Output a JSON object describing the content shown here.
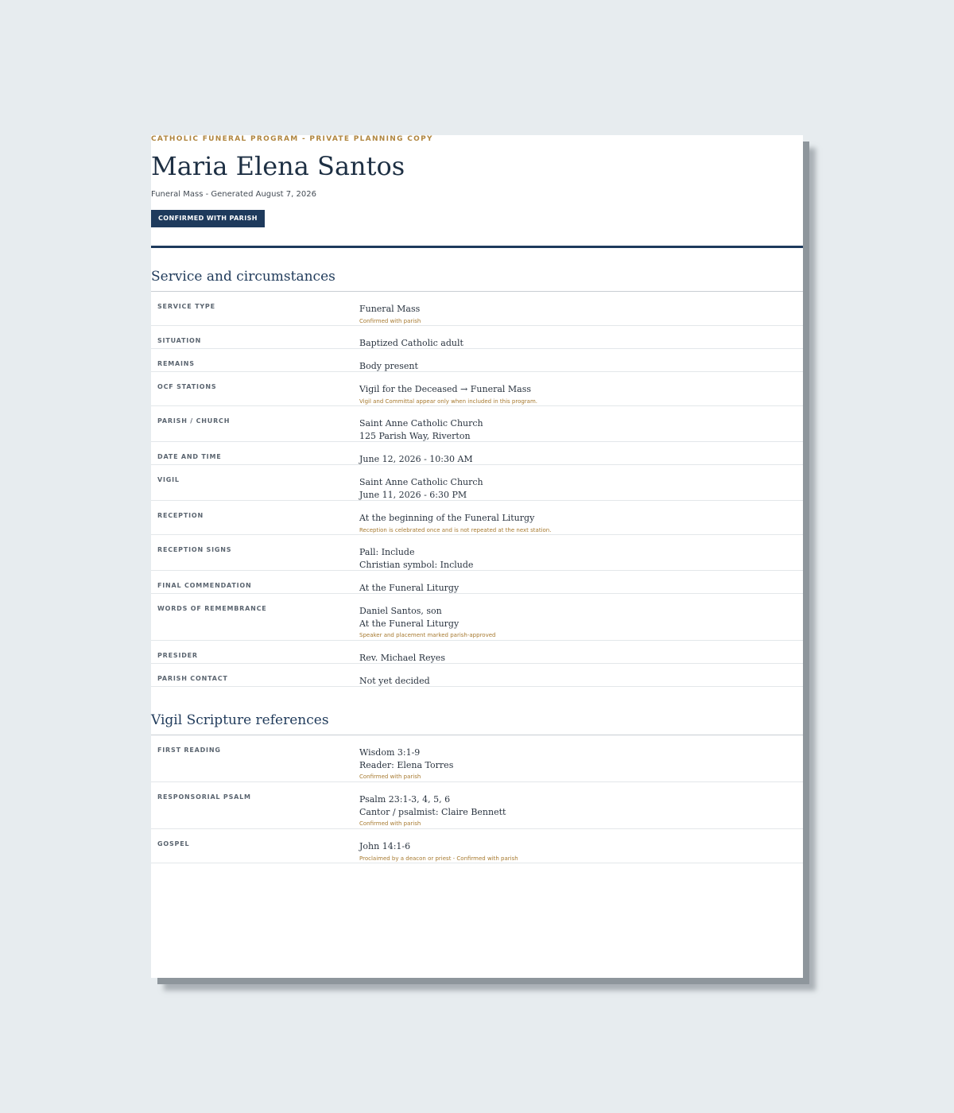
{
  "header": {
    "eyebrow": "CATHOLIC FUNERAL PROGRAM - PRIVATE PLANNING COPY",
    "name": "Maria Elena Santos",
    "generated": "Funeral Mass - Generated August 7, 2026",
    "status_badge": "CONFIRMED WITH PARISH"
  },
  "sections": [
    {
      "title": "Service and circumstances",
      "rows": [
        {
          "label": "SERVICE TYPE",
          "values": [
            "Funeral Mass"
          ],
          "note": "Confirmed with parish"
        },
        {
          "label": "SITUATION",
          "values": [
            "Baptized Catholic adult"
          ],
          "note": ""
        },
        {
          "label": "REMAINS",
          "values": [
            "Body present"
          ],
          "note": ""
        },
        {
          "label": "OCF STATIONS",
          "values": [
            "Vigil for the Deceased → Funeral Mass"
          ],
          "note": "Vigil and Committal appear only when included in this program."
        },
        {
          "label": "PARISH / CHURCH",
          "values": [
            "Saint Anne Catholic Church",
            "125 Parish Way, Riverton"
          ],
          "note": ""
        },
        {
          "label": "DATE AND TIME",
          "values": [
            "June 12, 2026 - 10:30 AM"
          ],
          "note": ""
        },
        {
          "label": "VIGIL",
          "values": [
            "Saint Anne Catholic Church",
            "June 11, 2026 - 6:30 PM"
          ],
          "note": ""
        },
        {
          "label": "RECEPTION",
          "values": [
            "At the beginning of the Funeral Liturgy"
          ],
          "note": "Reception is celebrated once and is not repeated at the next station."
        },
        {
          "label": "RECEPTION SIGNS",
          "values": [
            "Pall: Include",
            "Christian symbol: Include"
          ],
          "note": ""
        },
        {
          "label": "FINAL COMMENDATION",
          "values": [
            "At the Funeral Liturgy"
          ],
          "note": ""
        },
        {
          "label": "WORDS OF REMEMBRANCE",
          "values": [
            "Daniel Santos, son",
            "At the Funeral Liturgy"
          ],
          "note": "Speaker and placement marked parish-approved"
        },
        {
          "label": "PRESIDER",
          "values": [
            "Rev. Michael Reyes"
          ],
          "note": ""
        },
        {
          "label": "PARISH CONTACT",
          "values": [
            "Not yet decided"
          ],
          "note": ""
        }
      ]
    },
    {
      "title": "Vigil Scripture references",
      "rows": [
        {
          "label": "FIRST READING",
          "values": [
            "Wisdom 3:1-9",
            "Reader: Elena Torres"
          ],
          "note": "Confirmed with parish"
        },
        {
          "label": "RESPONSORIAL PSALM",
          "values": [
            "Psalm 23:1-3, 4, 5, 6",
            "Cantor / psalmist: Claire Bennett"
          ],
          "note": "Confirmed with parish"
        },
        {
          "label": "GOSPEL",
          "values": [
            "John 14:1-6"
          ],
          "note": "Proclaimed by a deacon or priest - Confirmed with parish"
        }
      ]
    }
  ]
}
